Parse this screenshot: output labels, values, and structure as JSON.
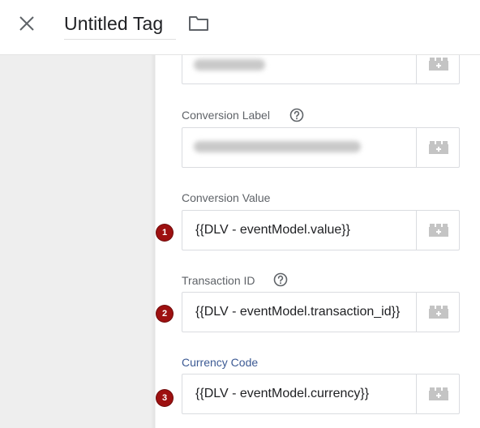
{
  "header": {
    "title": "Untitled Tag",
    "close_icon": "close-icon",
    "folder_icon": "folder-icon"
  },
  "fields": {
    "conversion_id": {
      "label": "",
      "value_hidden": true
    },
    "conversion_label": {
      "label": "Conversion Label",
      "help": true,
      "value_hidden": true
    },
    "conversion_value": {
      "label": "Conversion Value",
      "value": "{{DLV - eventModel.value}}",
      "badge": "1"
    },
    "transaction_id": {
      "label": "Transaction ID",
      "help": true,
      "value": "{{DLV - eventModel.transaction_id}}",
      "badge": "2"
    },
    "currency_code": {
      "label": "Currency Code",
      "value": "{{DLV - eventModel.currency}}",
      "badge": "3"
    }
  },
  "colors": {
    "badge": "#9d1010",
    "label": "#5f6368",
    "label_active": "#3c5a94",
    "variable_icon": "#c4c4c4"
  }
}
